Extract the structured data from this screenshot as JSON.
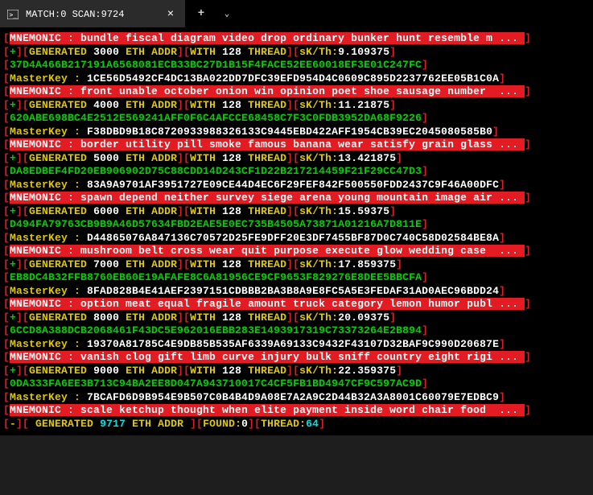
{
  "window": {
    "title": "MATCH:0 SCAN:9724"
  },
  "lines": [
    {
      "type": "mnemonic",
      "text": "bundle fiscal diagram video drop ordinary bunker hunt resemble m ..."
    },
    {
      "type": "gen",
      "count": "3000",
      "thread": "128",
      "skth": "9.109375"
    },
    {
      "type": "hash_green",
      "hex": "37D4A466B217191A6568081ECB33BC27D1B15F4FACE52EE60018EF3E01C247FC"
    },
    {
      "type": "master",
      "hex": "1CE56D5492CF4DC13BA022DD7DFC39EFD954D4C0609C895D2237762EE05B1C0A"
    },
    {
      "type": "mnemonic",
      "text": "front unable october onion win opinion poet shoe sausage number  ..."
    },
    {
      "type": "gen",
      "count": "4000",
      "thread": "128",
      "skth": "11.21875"
    },
    {
      "type": "hash_green",
      "hex": "620ABE698BC4E2512E569241AFF0F6C4AFCCE68458C7F3C0FDB3952DA68F9226"
    },
    {
      "type": "master",
      "hex": "F38DBD9B18C8720933988326133C9445EBD422AFF1954CB39EC2045080585B0"
    },
    {
      "type": "mnemonic",
      "text": "border utility pill smoke famous banana wear satisfy grain glass ..."
    },
    {
      "type": "gen",
      "count": "5000",
      "thread": "128",
      "skth": "13.421875"
    },
    {
      "type": "hash_green",
      "hex": "DA8EDBEF4FD20EB906902D75C88CDD14D243CF1D22B217214459F21F29CC47D3"
    },
    {
      "type": "master",
      "hex": "83A9A9701AF3951727E09CE44D4EC6F29FEF842F500550FDD2437C9F46A00DFC"
    },
    {
      "type": "mnemonic",
      "text": "spawn depend neither survey siege arena young mountain image air ..."
    },
    {
      "type": "gen",
      "count": "6000",
      "thread": "128",
      "skth": "15.59375"
    },
    {
      "type": "hash_green",
      "hex": "D494FA79763CB9B9A46D57634FBD2EAE5E0EC735B4505A73871A01216A7D811E"
    },
    {
      "type": "master",
      "hex": "D44865076A847136C70572D25FE9DFF20E3DF7455BF87D0C740C58D02584BE8A"
    },
    {
      "type": "mnemonic",
      "text": "mushroom belt cross wear quit purpose execute glow wedding case  ..."
    },
    {
      "type": "gen",
      "count": "7000",
      "thread": "128",
      "skth": "17.859375"
    },
    {
      "type": "hash_green",
      "hex": "EB8DC4B32FFB8760EB60E19AFAFE8C6A81956CE9CF9653F829276E8DEE5BBCFA"
    },
    {
      "type": "master",
      "hex": "8FAD828B4E41AEF2397151CDBBB2BA3B8A9E8FC5A5E3FEDAF31AD0AEC96BDD24"
    },
    {
      "type": "mnemonic",
      "text": "option meat equal fragile amount truck category lemon humor publ ..."
    },
    {
      "type": "gen",
      "count": "8000",
      "thread": "128",
      "skth": "20.09375"
    },
    {
      "type": "hash_green",
      "hex": "6CCD8A388DCB2068461F43DC5E962016EBB283E1493917319C73373264E2B894"
    },
    {
      "type": "master",
      "hex": "19370A81785C4E9DB85B535AF6339A69133C9432F43107D32BAF9C990D20687E"
    },
    {
      "type": "mnemonic",
      "text": "vanish clog gift limb curve injury bulk sniff country eight rigi ..."
    },
    {
      "type": "gen",
      "count": "9000",
      "thread": "128",
      "skth": "22.359375"
    },
    {
      "type": "hash_green",
      "hex": "0DA333FA6EE3B713C94BA2EE8D047A943710017C4CF5FB1BD4947CF9C597AC9D"
    },
    {
      "type": "master",
      "hex": "7BCAFD6D9B954E9B507C0B4B4D9A08E7A2A9C2D44B32A3A8001C60079E7EDBC9"
    },
    {
      "type": "mnemonic",
      "text": "scale ketchup thought when elite payment inside word chair food  ..."
    },
    {
      "type": "status",
      "count": "9717",
      "found": "0",
      "thread": "64"
    }
  ]
}
